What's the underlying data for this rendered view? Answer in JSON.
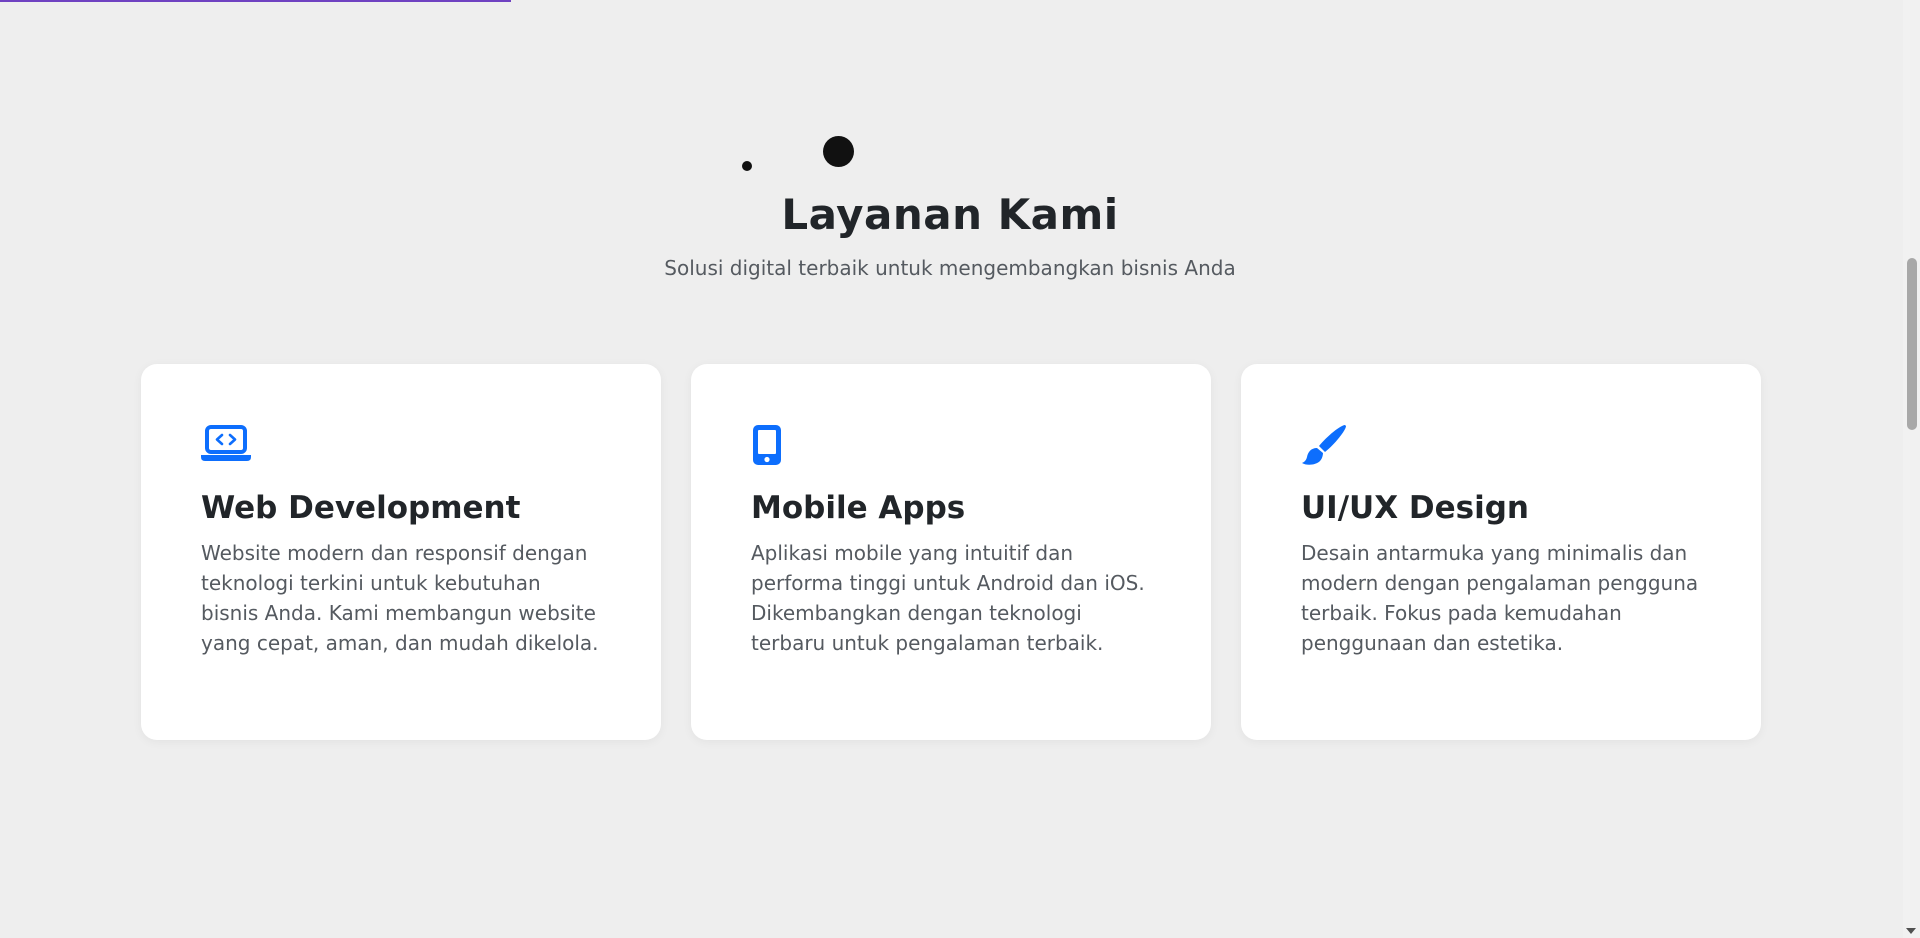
{
  "scroll_progress_percent": 26.6,
  "section": {
    "title": "Layanan Kami",
    "subtitle": "Solusi digital terbaik untuk mengembangkan bisnis Anda"
  },
  "services": [
    {
      "icon": "laptop-code-icon",
      "title": "Web Development",
      "description": "Website modern dan responsif dengan teknologi terkini untuk kebutuhan bisnis Anda. Kami membangun website yang cepat, aman, dan mudah dikelola."
    },
    {
      "icon": "mobile-phone-icon",
      "title": "Mobile Apps",
      "description": "Aplikasi mobile yang intuitif dan performa tinggi untuk Android dan iOS. Dikembangkan dengan teknologi terbaru untuk pengalaman terbaik."
    },
    {
      "icon": "paint-brush-icon",
      "title": "UI/UX Design",
      "description": "Desain antarmuka yang minimalis dan modern dengan pengalaman pengguna terbaik. Fokus pada kemudahan penggunaan dan estetika."
    }
  ],
  "colors": {
    "accent": "#0d6efd",
    "progress": "#6f42c1",
    "background": "#eeeeee",
    "card": "#ffffff"
  }
}
